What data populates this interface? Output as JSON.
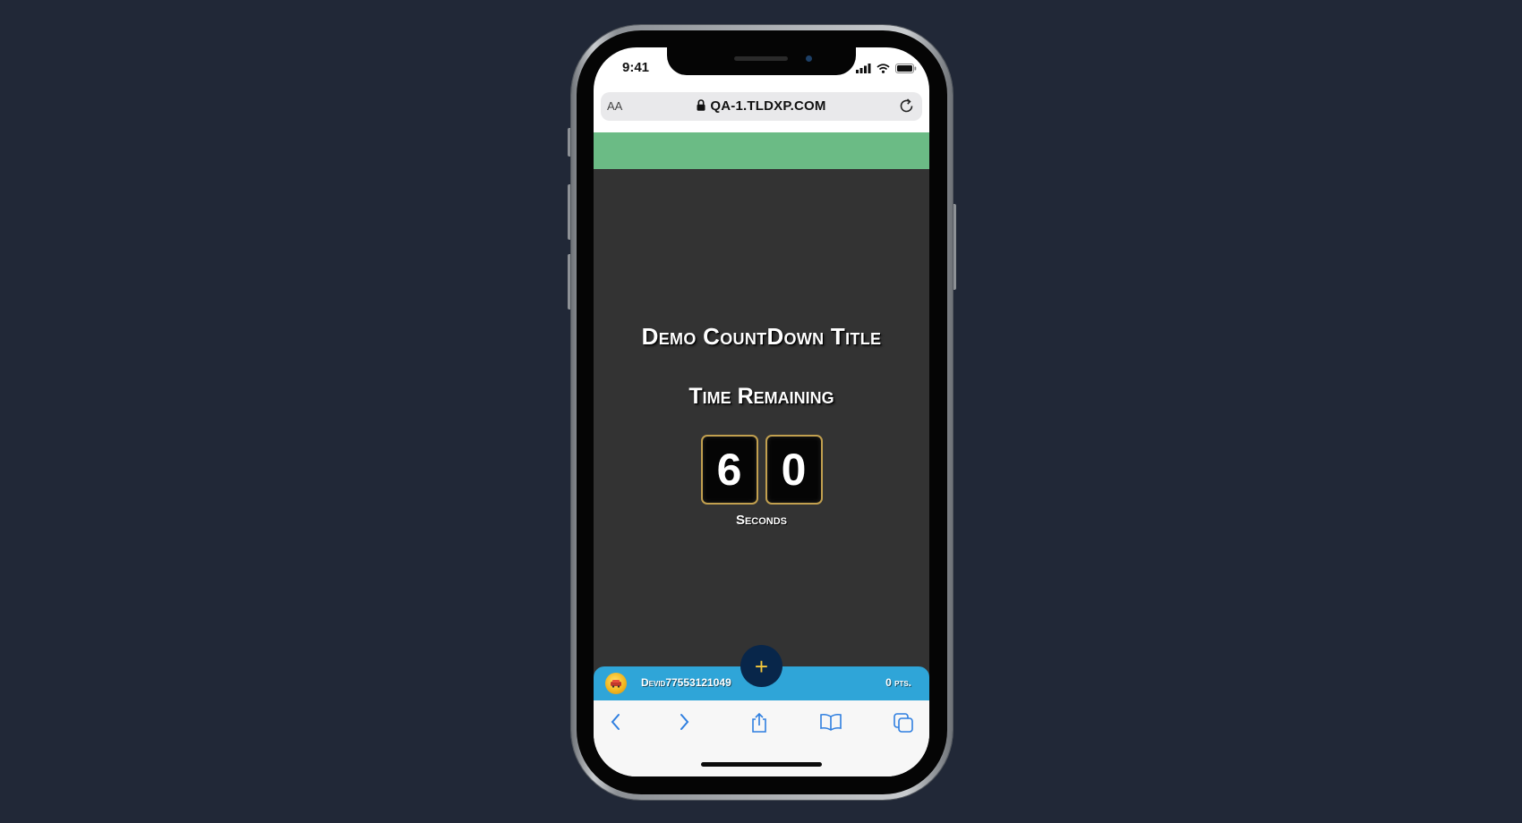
{
  "status_bar": {
    "time": "9:41"
  },
  "browser": {
    "text_size_label": "AA",
    "url": "QA-1.TLDXP.COM"
  },
  "countdown": {
    "title": "Demo CountDown Title",
    "subtitle": "Time Remaining",
    "digits": [
      "6",
      "0"
    ],
    "unit_label": "Seconds"
  },
  "user_bar": {
    "username": "Devid77553121049",
    "points": "0 pts.",
    "add_button_label": "+"
  },
  "colors": {
    "page_background": "#212837",
    "banner": "#6bbb85",
    "content_background": "#333333",
    "user_bar": "#2fa5d8",
    "digit_border": "#c2a04f",
    "fab": "#08264a",
    "fab_plus": "#f4c73c",
    "safari_blue": "#2f7fe0"
  },
  "icons": {
    "status": [
      "signal-icon",
      "wifi-icon",
      "battery-icon"
    ],
    "browser": [
      "lock-icon",
      "reload-icon"
    ],
    "toolbar": [
      "back-icon",
      "forward-icon",
      "share-icon",
      "bookmarks-icon",
      "tabs-icon"
    ]
  }
}
